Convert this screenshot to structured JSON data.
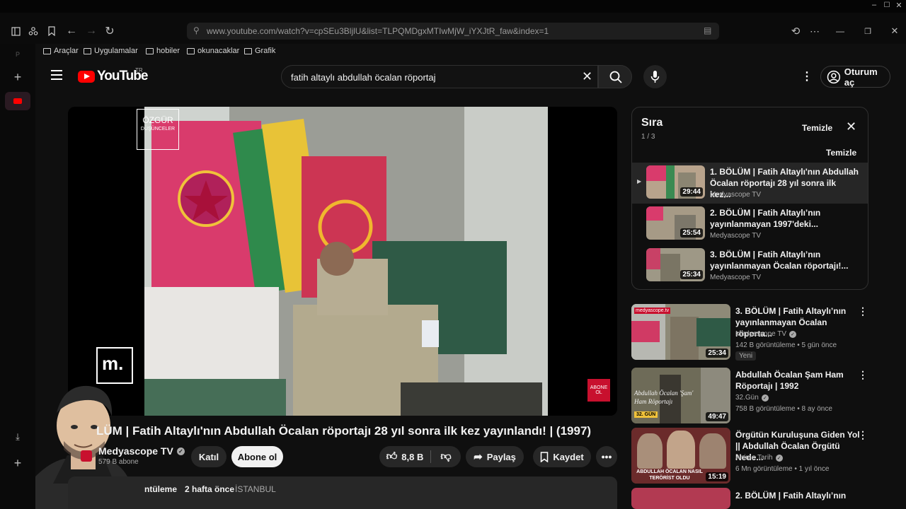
{
  "browser": {
    "url": "www.youtube.com/watch?v=cpSEu3BljlU&list=TLPQMDgxMTIwMjW_iYXJtR_faw&index=1",
    "bookmarks": [
      "Araçlar",
      "Uygulamalar",
      "hobiler",
      "okunacaklar",
      "Grafik"
    ]
  },
  "header": {
    "logo": "YouTube",
    "region": "TR",
    "search_value": "fatih altaylı abdullah öcalan röportaj",
    "signin_label": "Oturum aç"
  },
  "video": {
    "watermark_line1": "ÖZGÜR",
    "watermark_line2": "DÜŞÜNCELER",
    "channel_badge": "m.",
    "corner_badge": "ABONE OL",
    "title": "LÜM | Fatih Altaylı'nın Abdullah Öcalan röportajı 28 yıl sonra ilk kez yayınlandı! | (1997)",
    "channel": "Medyascope TV",
    "subscribers": "579 B abone",
    "join_label": "Katıl",
    "subscribe_label": "Abone ol",
    "likes": "8,8 B",
    "share_label": "Paylaş",
    "save_label": "Kaydet",
    "desc_views": "ntüleme",
    "desc_when": "2 hafta önce",
    "desc_tag": "İSTANBUL"
  },
  "queue": {
    "title": "Sıra",
    "position": "1 / 3",
    "clear_label": "Temizle",
    "clear_label2": "Temizle",
    "items": [
      {
        "title": "1. BÖLÜM | Fatih Altaylı'nın Abdullah Öcalan röportajı 28 yıl sonra ilk kez...",
        "channel": "Medyascope TV",
        "duration": "29:44"
      },
      {
        "title": "2. BÖLÜM | Fatih Altaylı’nın yayınlanmayan 1997'deki...",
        "channel": "Medyascope TV",
        "duration": "25:54"
      },
      {
        "title": "3. BÖLÜM | Fatih Altaylı’nın yayınlanmayan Öcalan röportajı!...",
        "channel": "Medyascope TV",
        "duration": "25:34"
      }
    ]
  },
  "recommended": [
    {
      "title": "3. BÖLÜM | Fatih Altaylı’nın yayınlanmayan Öcalan röporta...",
      "channel": "Medyascope TV",
      "meta": "142 B görüntüleme • 5 gün önce",
      "badge": "Yeni",
      "duration": "25:34",
      "thumb_label": "medyascope.tv"
    },
    {
      "title": "Abdullah Öcalan Şam Ham Röportajı | 1992",
      "channel": "32.Gün",
      "meta": "758 B görüntüleme • 8 ay önce",
      "badge": "",
      "duration": "49:47",
      "thumb_label": "Abdullah Öcalan 'Şam' Ham Röportajı",
      "thumb_tag": "32. GÜN"
    },
    {
      "title": "Örgütün Kuruluşuna Giden Yol || Abdullah Öcalan Örgütü Nede...",
      "channel": "Anime Tarih",
      "meta": "6 Mn görüntüleme • 1 yıl önce",
      "badge": "",
      "duration": "15:19",
      "thumb_label": "ABDULLAH ÖCALAN NASIL TERÖRİST OLDU"
    },
    {
      "title": "2. BÖLÜM | Fatih Altaylı’nın",
      "channel": "",
      "meta": "",
      "badge": "",
      "duration": "",
      "thumb_label": ""
    }
  ]
}
